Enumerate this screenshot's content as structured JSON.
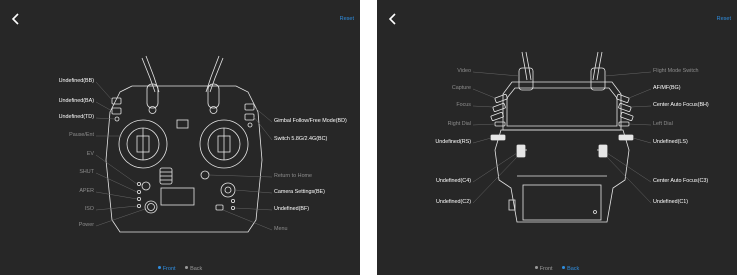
{
  "colors": {
    "background": "#272727",
    "accent": "#2f8ee0",
    "label_active": "#ffffff",
    "label_inactive": "#8d8d8d",
    "outline": "#e6e6e6"
  },
  "front": {
    "reset": "Reset",
    "labels_left": [
      "Undefined(BB)",
      "Undefined(BA)",
      "Undefined(TD)",
      "Pause/Ent",
      "EV",
      "SHUT",
      "APER",
      "ISO",
      "Power"
    ],
    "labels_right": [
      "Gimbal Follow/Free Mode(BD)",
      "Switch 5.8G/2.4G(BC)",
      "Return to Home",
      "Camera Settings(BE)",
      "Undefined(BF)",
      "Menu"
    ],
    "tabs": [
      "Front",
      "Back"
    ],
    "active_tab": "Front"
  },
  "back": {
    "reset": "Reset",
    "labels_left": [
      "Video",
      "Capture",
      "Focus",
      "Right Dial",
      "Undefined(RS)",
      "Undefined(C4)",
      "Undefined(C2)"
    ],
    "labels_right": [
      "Flight Mode Switch",
      "AF/MF(BG)",
      "Center Auto Focus(BH)",
      "Left Dial",
      "Undefined(LS)",
      "Center Auto Focus(C3)",
      "Undefined(C1)"
    ],
    "tabs": [
      "Front",
      "Back"
    ],
    "active_tab": "Back"
  }
}
